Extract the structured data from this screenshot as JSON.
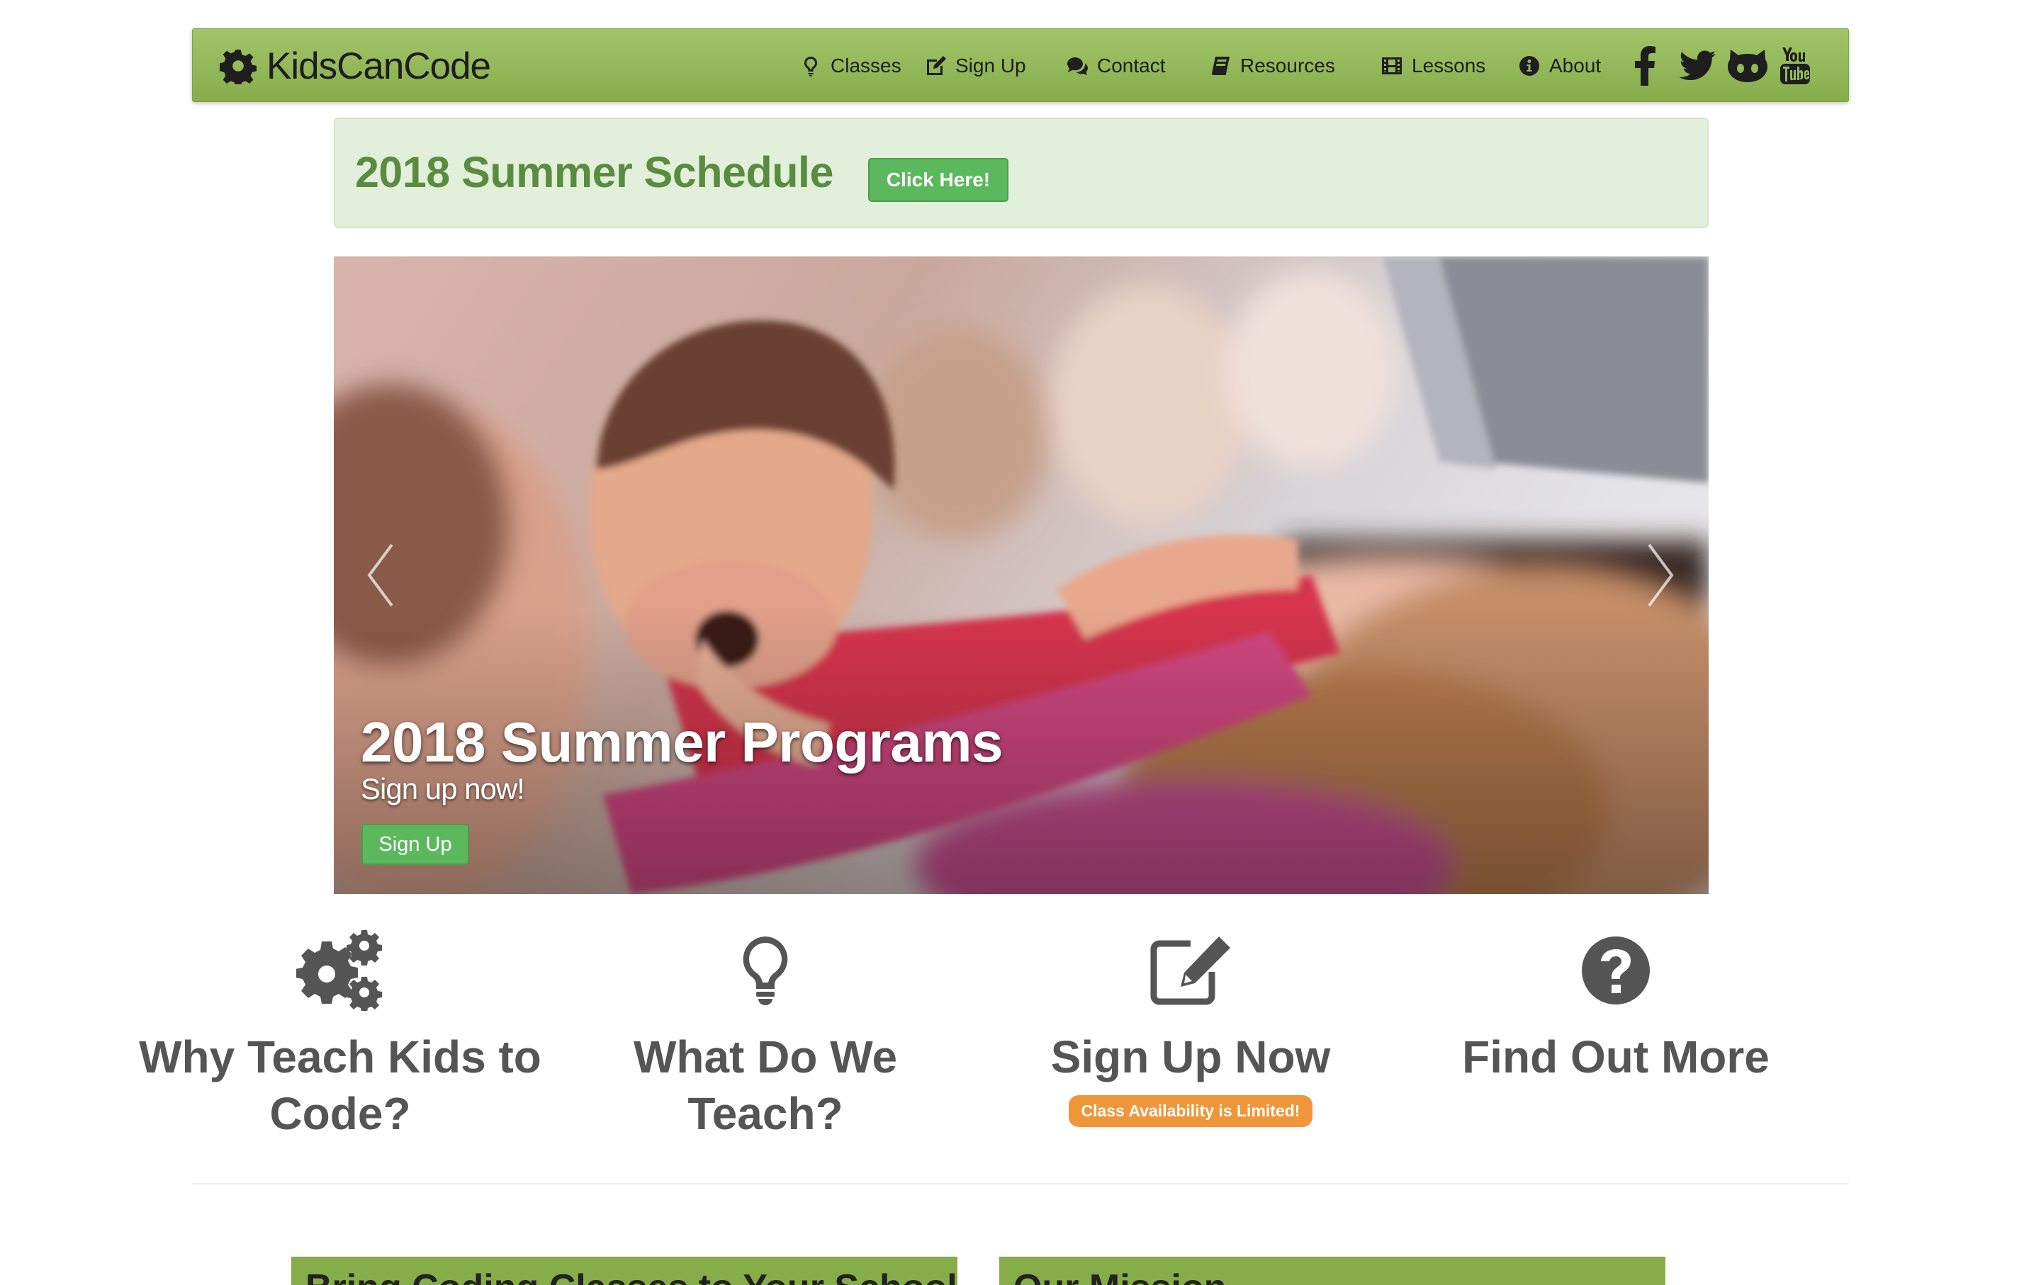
{
  "nav": {
    "brand": "KidsCanCode",
    "links": [
      {
        "label": "Classes",
        "icon": "lightbulb-icon"
      },
      {
        "label": "Sign Up",
        "icon": "edit-icon"
      },
      {
        "label": "Contact",
        "icon": "comments-icon"
      },
      {
        "label": "Resources",
        "icon": "book-icon"
      },
      {
        "label": "Lessons",
        "icon": "film-icon"
      },
      {
        "label": "About",
        "icon": "info-icon"
      }
    ],
    "social": [
      "facebook-icon",
      "twitter-icon",
      "github-icon",
      "youtube-icon"
    ]
  },
  "alert": {
    "title": "2018 Summer Schedule",
    "button": "Click Here!"
  },
  "carousel": {
    "title": "2018 Summer Programs",
    "subtitle": "Sign up now!",
    "button": "Sign Up"
  },
  "features": [
    {
      "title": "Why Teach Kids to Code?",
      "icon": "cogs-icon"
    },
    {
      "title": "What Do We Teach?",
      "icon": "lightbulb-icon"
    },
    {
      "title": "Sign Up Now",
      "icon": "edit-icon",
      "badge": "Class Availability is Limited!"
    },
    {
      "title": "Find Out More",
      "icon": "question-circle-icon"
    }
  ],
  "panels": [
    {
      "title": "Bring Coding Classes to Your School"
    },
    {
      "title": "Our Mission"
    }
  ],
  "colors": {
    "nav_green": "#8db452",
    "alert_bg": "#e2efda",
    "alert_text": "#5a8c3f",
    "button_green": "#5cb85c",
    "badge_orange": "#f0963a"
  }
}
